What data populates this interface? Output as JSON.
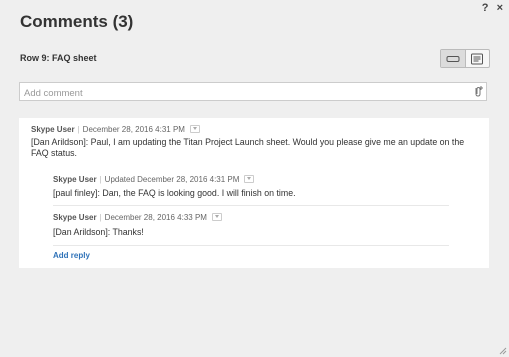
{
  "window": {
    "help_icon": "?",
    "close_icon": "×"
  },
  "title": "Comments (3)",
  "row_label": "Row 9:  FAQ sheet",
  "add_comment": {
    "placeholder": "Add comment"
  },
  "comments": [
    {
      "user": "Skype User",
      "timestamp": "December 28, 2016 4:31 PM",
      "text": "[Dan Arildson]: Paul, I am updating the Titan Project Launch sheet. Would you please give me an update on the FAQ status."
    }
  ],
  "replies": [
    {
      "user": "Skype User",
      "timestamp": "Updated December 28, 2016 4:31 PM",
      "text": "[paul finley]: Dan, the FAQ is looking good. I will finish on time."
    },
    {
      "user": "Skype User",
      "timestamp": "December 28, 2016 4:33 PM",
      "text": "[Dan Arildson]: Thanks!"
    }
  ],
  "add_reply_label": "Add reply",
  "colors": {
    "background": "#efefef",
    "panel": "#ffffff",
    "link": "#2f72b8"
  }
}
